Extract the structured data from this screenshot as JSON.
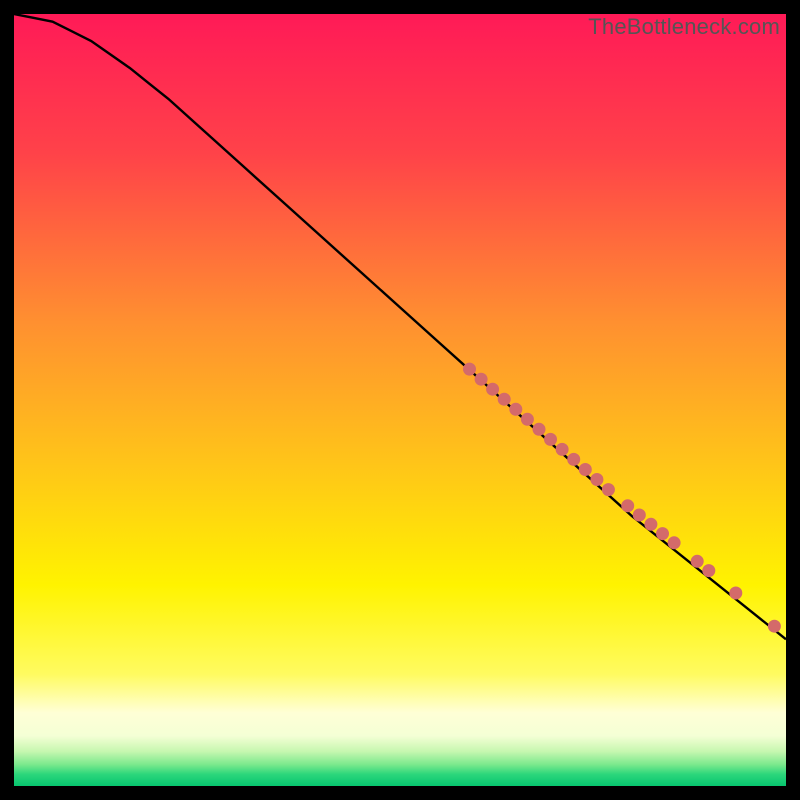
{
  "watermark": "TheBottleneck.com",
  "chart_data": {
    "type": "line",
    "title": "",
    "xlabel": "",
    "ylabel": "",
    "xlim": [
      0,
      100
    ],
    "ylim": [
      0,
      100
    ],
    "grid": false,
    "legend": false,
    "background_gradient": {
      "stops": [
        {
          "pos": 0.0,
          "color": "#ff1a57"
        },
        {
          "pos": 0.18,
          "color": "#ff4249"
        },
        {
          "pos": 0.4,
          "color": "#ff9030"
        },
        {
          "pos": 0.58,
          "color": "#ffc419"
        },
        {
          "pos": 0.74,
          "color": "#fff300"
        },
        {
          "pos": 0.855,
          "color": "#fffb60"
        },
        {
          "pos": 0.905,
          "color": "#ffffd6"
        },
        {
          "pos": 0.935,
          "color": "#f4ffd5"
        },
        {
          "pos": 0.955,
          "color": "#c7f7b0"
        },
        {
          "pos": 0.972,
          "color": "#7ce98d"
        },
        {
          "pos": 0.985,
          "color": "#2bd67b"
        },
        {
          "pos": 1.0,
          "color": "#07c56f"
        }
      ]
    },
    "curve": {
      "color": "#000000",
      "width": 2.4,
      "points": [
        {
          "x": 0,
          "y": 100
        },
        {
          "x": 5,
          "y": 99
        },
        {
          "x": 10,
          "y": 96.5
        },
        {
          "x": 15,
          "y": 93
        },
        {
          "x": 20,
          "y": 89
        },
        {
          "x": 30,
          "y": 80
        },
        {
          "x": 40,
          "y": 71
        },
        {
          "x": 50,
          "y": 62
        },
        {
          "x": 60,
          "y": 53
        },
        {
          "x": 70,
          "y": 44
        },
        {
          "x": 80,
          "y": 35
        },
        {
          "x": 90,
          "y": 27
        },
        {
          "x": 100,
          "y": 19
        }
      ]
    },
    "marker_series": {
      "color": "#d46a6a",
      "radius": 6.5,
      "points": [
        {
          "x": 59.0,
          "y": 54.0
        },
        {
          "x": 60.5,
          "y": 52.7
        },
        {
          "x": 62.0,
          "y": 51.4
        },
        {
          "x": 63.5,
          "y": 50.1
        },
        {
          "x": 65.0,
          "y": 48.8
        },
        {
          "x": 66.5,
          "y": 47.5
        },
        {
          "x": 68.0,
          "y": 46.2
        },
        {
          "x": 69.5,
          "y": 44.9
        },
        {
          "x": 71.0,
          "y": 43.6
        },
        {
          "x": 72.5,
          "y": 42.3
        },
        {
          "x": 74.0,
          "y": 41.0
        },
        {
          "x": 75.5,
          "y": 39.7
        },
        {
          "x": 77.0,
          "y": 38.4
        },
        {
          "x": 79.5,
          "y": 36.3
        },
        {
          "x": 81.0,
          "y": 35.1
        },
        {
          "x": 82.5,
          "y": 33.9
        },
        {
          "x": 84.0,
          "y": 32.7
        },
        {
          "x": 85.5,
          "y": 31.5
        },
        {
          "x": 88.5,
          "y": 29.1
        },
        {
          "x": 90.0,
          "y": 27.9
        },
        {
          "x": 93.5,
          "y": 25.0
        },
        {
          "x": 98.5,
          "y": 20.7
        }
      ]
    }
  }
}
